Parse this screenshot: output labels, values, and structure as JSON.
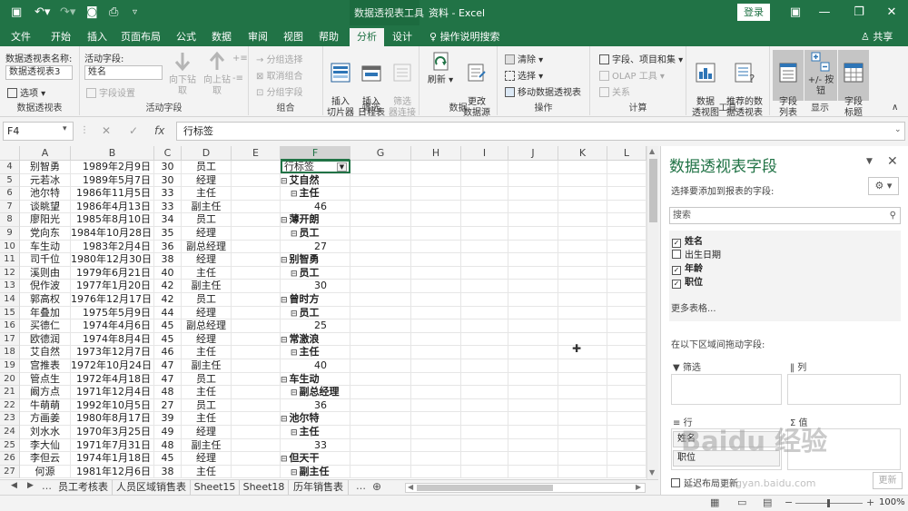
{
  "titlebar": {
    "context_tool": "数据透视表工具",
    "doc_title": "资料 - Excel",
    "login": "登录"
  },
  "tabs": [
    "文件",
    "开始",
    "插入",
    "页面布局",
    "公式",
    "数据",
    "审阅",
    "视图",
    "帮助",
    "分析",
    "设计"
  ],
  "active_tab": "分析",
  "tell_me": "操作说明搜索",
  "share": "共享",
  "ribbon": {
    "pivot_name_label": "数据透视表名称:",
    "pivot_name_value": "数据透视表3",
    "options_label": "选项",
    "group_pivot": "数据透视表",
    "active_field_label": "活动字段:",
    "active_field_value": "姓名",
    "field_settings": "字段设置",
    "drill_down": "向下钻取",
    "drill_up": "向上钻取",
    "group_active": "活动字段",
    "group_selection": "分组选择",
    "ungroup": "取消组合",
    "group_field": "分组字段",
    "group_group": "组合",
    "insert_slicer": "插入\n切片器",
    "insert_timeline": "插入\n日程表",
    "filter_conn": "筛选\n器连接",
    "group_filter": "筛选",
    "refresh": "刷新",
    "change_source": "更改\n数据源",
    "group_data": "数据",
    "clear": "清除",
    "select": "选择",
    "move_pivot": "移动数据透视表",
    "group_actions": "操作",
    "fields_items": "字段、项目和集",
    "olap": "OLAP 工具",
    "relations": "关系",
    "group_calc": "计算",
    "pivot_chart": "数据\n透视图",
    "recommended": "推荐的数\n据透视表",
    "group_tools": "工具",
    "field_list": "字段\n列表",
    "plus_minus": "+/- 按钮",
    "field_headers": "字段\n标题",
    "group_show": "显示"
  },
  "formula_bar": {
    "name_box": "F4",
    "formula": "行标签"
  },
  "columns": [
    "A",
    "B",
    "C",
    "D",
    "E",
    "F",
    "G",
    "H",
    "I",
    "J",
    "K",
    "L"
  ],
  "rows": [
    {
      "n": "4",
      "a": "别智勇",
      "b": "1989年2月9日",
      "c": "30",
      "d": "员工",
      "f": "行标签",
      "ft": "hdr"
    },
    {
      "n": "5",
      "a": "元若冰",
      "b": "1989年5月7日",
      "c": "30",
      "d": "经理",
      "f": "艾自然",
      "ft": "l1"
    },
    {
      "n": "6",
      "a": "池尔特",
      "b": "1986年11月5日",
      "c": "33",
      "d": "主任",
      "f": "主任",
      "ft": "l2"
    },
    {
      "n": "7",
      "a": "谈眺望",
      "b": "1986年4月13日",
      "c": "33",
      "d": "副主任",
      "f": "46",
      "ft": "v"
    },
    {
      "n": "8",
      "a": "廖阳光",
      "b": "1985年8月10日",
      "c": "34",
      "d": "员工",
      "f": "薄开朗",
      "ft": "l1"
    },
    {
      "n": "9",
      "a": "党向东",
      "b": "1984年10月28日",
      "c": "35",
      "d": "经理",
      "f": "员工",
      "ft": "l2"
    },
    {
      "n": "10",
      "a": "车生动",
      "b": "1983年2月4日",
      "c": "36",
      "d": "副总经理",
      "f": "27",
      "ft": "v"
    },
    {
      "n": "11",
      "a": "司千位",
      "b": "1980年12月30日",
      "c": "38",
      "d": "经理",
      "f": "别智勇",
      "ft": "l1"
    },
    {
      "n": "12",
      "a": "溪则由",
      "b": "1979年6月21日",
      "c": "40",
      "d": "主任",
      "f": "员工",
      "ft": "l2"
    },
    {
      "n": "13",
      "a": "倪作波",
      "b": "1977年1月20日",
      "c": "42",
      "d": "副主任",
      "f": "30",
      "ft": "v"
    },
    {
      "n": "14",
      "a": "郭高权",
      "b": "1976年12月17日",
      "c": "42",
      "d": "员工",
      "f": "曾时方",
      "ft": "l1"
    },
    {
      "n": "15",
      "a": "年叠加",
      "b": "1975年5月9日",
      "c": "44",
      "d": "经理",
      "f": "员工",
      "ft": "l2"
    },
    {
      "n": "16",
      "a": "买德仁",
      "b": "1974年4月6日",
      "c": "45",
      "d": "副总经理",
      "f": "25",
      "ft": "v"
    },
    {
      "n": "17",
      "a": "欧德润",
      "b": "1974年8月4日",
      "c": "45",
      "d": "经理",
      "f": "常激浪",
      "ft": "l1"
    },
    {
      "n": "18",
      "a": "艾自然",
      "b": "1973年12月7日",
      "c": "46",
      "d": "主任",
      "f": "主任",
      "ft": "l2"
    },
    {
      "n": "19",
      "a": "宫推表",
      "b": "1972年10月24日",
      "c": "47",
      "d": "副主任",
      "f": "40",
      "ft": "v"
    },
    {
      "n": "20",
      "a": "管点生",
      "b": "1972年4月18日",
      "c": "47",
      "d": "员工",
      "f": "车生动",
      "ft": "l1"
    },
    {
      "n": "21",
      "a": "阚方点",
      "b": "1971年12月4日",
      "c": "48",
      "d": "主任",
      "f": "副总经理",
      "ft": "l2"
    },
    {
      "n": "22",
      "a": "牛萌萌",
      "b": "1992年10月5日",
      "c": "27",
      "d": "员工",
      "f": "36",
      "ft": "v"
    },
    {
      "n": "23",
      "a": "方画姜",
      "b": "1980年8月17日",
      "c": "39",
      "d": "主任",
      "f": "池尔特",
      "ft": "l1"
    },
    {
      "n": "24",
      "a": "刘水水",
      "b": "1970年3月25日",
      "c": "49",
      "d": "经理",
      "f": "主任",
      "ft": "l2"
    },
    {
      "n": "25",
      "a": "李大仙",
      "b": "1971年7月31日",
      "c": "48",
      "d": "副主任",
      "f": "33",
      "ft": "v"
    },
    {
      "n": "26",
      "a": "李但云",
      "b": "1974年1月18日",
      "c": "45",
      "d": "经理",
      "f": "但天干",
      "ft": "l1"
    },
    {
      "n": "27",
      "a": "何源",
      "b": "1981年12月6日",
      "c": "38",
      "d": "主任",
      "f": "副主任",
      "ft": "l2"
    }
  ],
  "sheet_tabs": [
    "员工考核表",
    "人员区域销售表",
    "Sheet15",
    "Sheet18",
    "历年销售表"
  ],
  "pane": {
    "title": "数据透视表字段",
    "choose_label": "选择要添加到报表的字段:",
    "search_placeholder": "搜索",
    "fields": [
      {
        "name": "姓名",
        "checked": true
      },
      {
        "name": "出生日期",
        "checked": false
      },
      {
        "name": "年龄",
        "checked": true
      },
      {
        "name": "职位",
        "checked": true
      }
    ],
    "more_tables": "更多表格...",
    "drag_label": "在以下区域间拖动字段:",
    "filter_area": "筛选",
    "column_area": "列",
    "row_area": "行",
    "value_area": "值",
    "row_items": [
      "姓名",
      "职位"
    ],
    "defer_label": "延迟布局更新",
    "update_btn": "更新"
  },
  "status": {
    "zoom": "100%"
  },
  "watermark": "Baidu 经验",
  "watermark_url": "jingyan.baidu.com"
}
